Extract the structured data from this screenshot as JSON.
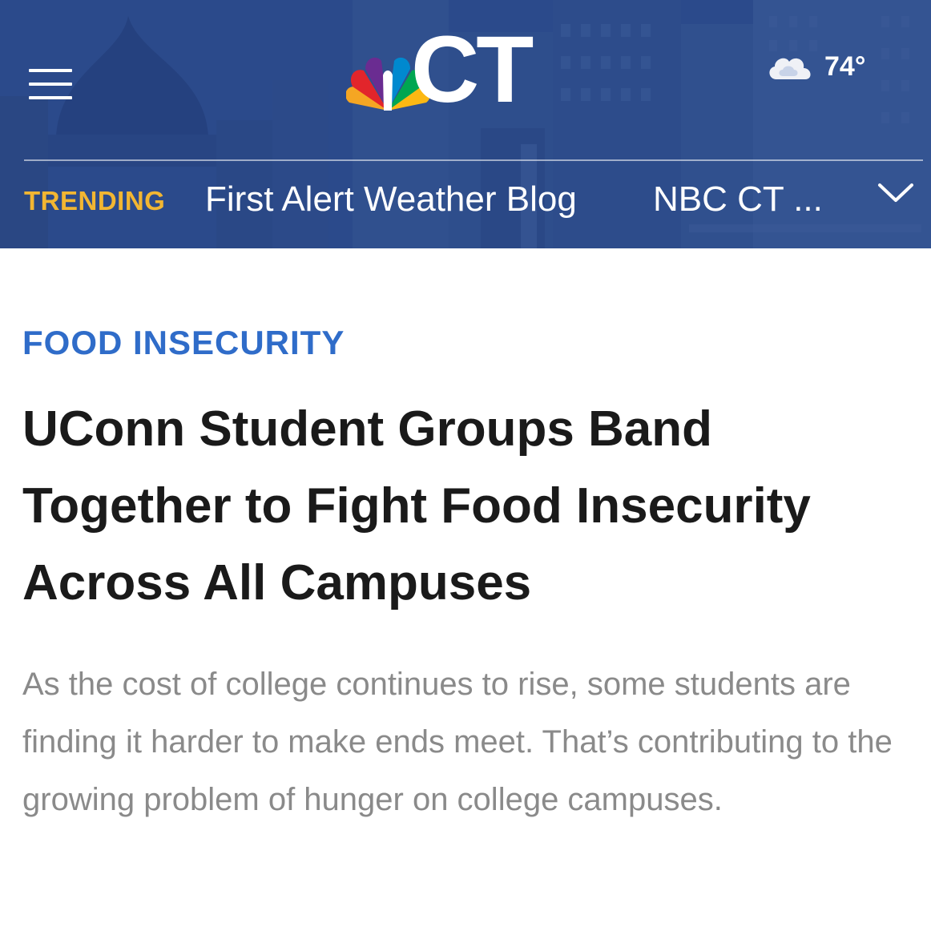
{
  "header": {
    "logo_text": "CT",
    "logo_icon": "nbc-peacock-icon",
    "menu_icon": "hamburger-menu-icon",
    "weather": {
      "icon": "cloudy-icon",
      "temperature": "74°"
    },
    "trending": {
      "label": "TRENDING",
      "items": [
        "First Alert Weather Blog",
        "NBC CT ..."
      ],
      "expand_icon": "chevron-down-icon"
    }
  },
  "article": {
    "category": "FOOD INSECURITY",
    "headline": "UConn Student Groups Band Together to Fight Food Insecurity Across All Campuses",
    "summary": "As the cost of college continues to rise, some students are finding it harder to make ends meet. That’s contributing to the growing problem of hunger on college campuses."
  },
  "colors": {
    "header_bg": "#2c4a8a",
    "trending_label": "#f2b632",
    "category": "#2f6cc9",
    "headline": "#1a1a1a",
    "summary": "#8a8a8a"
  }
}
